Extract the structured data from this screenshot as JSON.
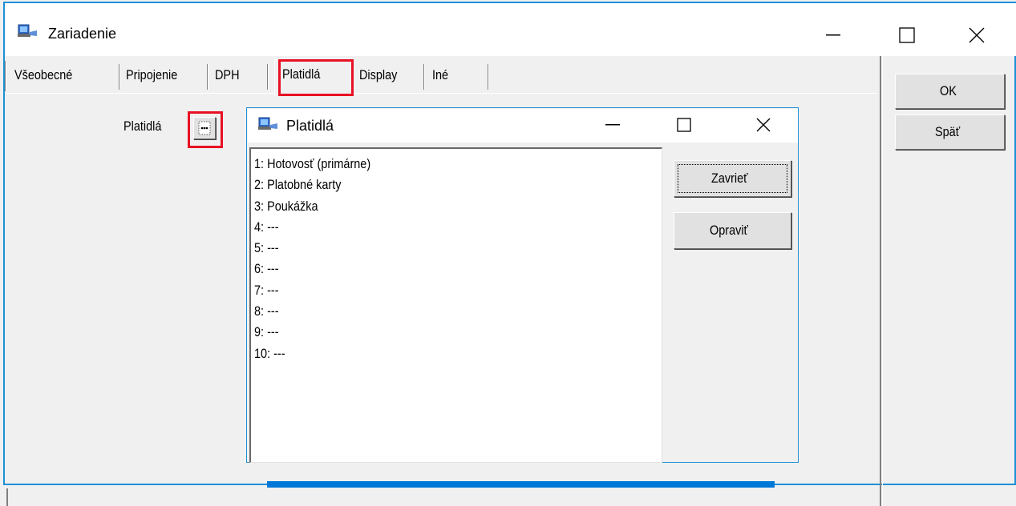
{
  "main_window": {
    "title": "Zariadenie",
    "tabs": [
      {
        "label": "Všeobecné"
      },
      {
        "label": "Pripojenie"
      },
      {
        "label": "DPH"
      },
      {
        "label": "Platidlá",
        "active": true
      },
      {
        "label": "Display"
      },
      {
        "label": "Iné"
      }
    ],
    "field_label": "Platidlá",
    "ok_label": "OK",
    "back_label": "Späť"
  },
  "dialog": {
    "title": "Platidlá",
    "items": [
      "1: Hotovosť (primárne)",
      "2: Platobné karty",
      "3: Poukážka",
      "4: ---",
      "5: ---",
      "6: ---",
      "7: ---",
      "8: ---",
      "9: ---",
      "10: ---"
    ],
    "close_label": "Zavrieť",
    "edit_label": "Opraviť"
  },
  "colors": {
    "highlight": "#e81123",
    "window_border": "#1e90d6",
    "accent_bar": "#0078d7"
  },
  "icons": {
    "app": "computer-icon",
    "browse": "ellipsis-browse-icon",
    "minimize": "minimize-icon",
    "maximize": "maximize-icon",
    "close": "close-icon"
  }
}
